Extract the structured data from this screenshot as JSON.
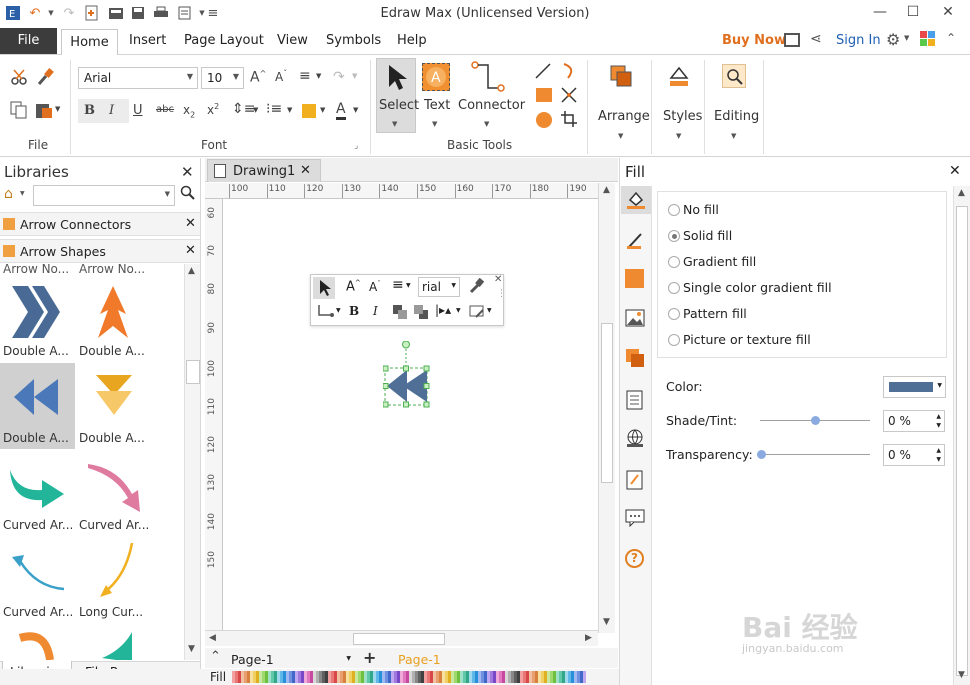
{
  "window": {
    "title": "Edraw Max (Unlicensed Version)"
  },
  "menu": {
    "file": "File",
    "tabs": [
      "Home",
      "Insert",
      "Page Layout",
      "View",
      "Symbols",
      "Help"
    ],
    "buy_now": "Buy Now",
    "sign_in": "Sign In"
  },
  "ribbon": {
    "font_name": "Arial",
    "font_size": "10",
    "group_file": "File",
    "group_font": "Font",
    "group_basic_tools": "Basic Tools",
    "select": "Select",
    "text": "Text",
    "connector": "Connector",
    "arrange": "Arrange",
    "styles": "Styles",
    "editing": "Editing"
  },
  "libraries": {
    "title": "Libraries",
    "search_placeholder": "",
    "sections": [
      "Arrow Connectors",
      "Arrow Shapes"
    ],
    "cut_labels": [
      "Arrow No...",
      "Arrow No..."
    ],
    "shapes": [
      {
        "label": "Double A...",
        "color": "#4a6a96"
      },
      {
        "label": "Double A...",
        "color": "#f07a2a"
      },
      {
        "label": "Double A...",
        "color": "#4a78b8"
      },
      {
        "label": "Double A...",
        "color": "#e8a520"
      },
      {
        "label": "Curved Ar...",
        "color": "#23b59a"
      },
      {
        "label": "Curved Ar...",
        "color": "#e07ba0"
      },
      {
        "label": "Curved Ar...",
        "color": "#3aa0c8"
      },
      {
        "label": "Long Cur...",
        "color": "#f0b020"
      }
    ],
    "bottom_tabs": [
      "Libraries",
      "File Recovery"
    ]
  },
  "document": {
    "tab": "Drawing1",
    "ruler_h": [
      "100",
      "110",
      "120",
      "130",
      "140",
      "150",
      "160",
      "170",
      "180",
      "190"
    ],
    "ruler_v": [
      "60",
      "70",
      "80",
      "90",
      "100",
      "110",
      "120",
      "130",
      "140",
      "150"
    ],
    "floating_font": "rial",
    "page_select": "Page-1",
    "page_tab": "Page-1",
    "fill_label": "Fill"
  },
  "fill_panel": {
    "title": "Fill",
    "options": [
      "No fill",
      "Solid fill",
      "Gradient fill",
      "Single color gradient fill",
      "Pattern fill",
      "Picture or texture fill"
    ],
    "selected": "Solid fill",
    "color_label": "Color:",
    "color_value": "#4f6f96",
    "shade_label": "Shade/Tint:",
    "shade_value": "0 %",
    "transparency_label": "Transparency:",
    "transparency_value": "0 %"
  },
  "watermark": {
    "main": "Bai 经验",
    "sub": "jingyan.baidu.com"
  },
  "colors": {
    "accent": "#f07a2a",
    "shape_fill": "#4f6f96",
    "file_tab": "#3c3c3c"
  }
}
